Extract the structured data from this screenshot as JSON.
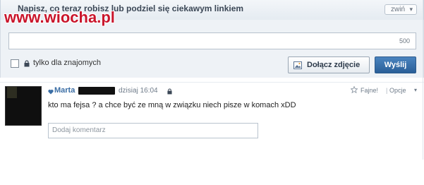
{
  "header": {
    "title": "Napisz, co teraz robisz lub podziel się ciekawym linkiem",
    "collapse_label": "zwiń"
  },
  "watermark": "www.wiocha.pl",
  "composer": {
    "input_value": "",
    "char_limit": "500",
    "friends_only_label": "tylko dla znajomych",
    "attach_label": "Dołącz zdjęcie",
    "send_label": "Wyślij"
  },
  "post": {
    "author": "Marta",
    "timestamp": "dzisiaj 16:04",
    "like_label": "Fajne!",
    "options_label": "Opcje",
    "text": "kto ma fejsa ? a chce być ze mną w związku niech pisze w komach xDD",
    "comment_placeholder": "Dodaj komentarz"
  }
}
